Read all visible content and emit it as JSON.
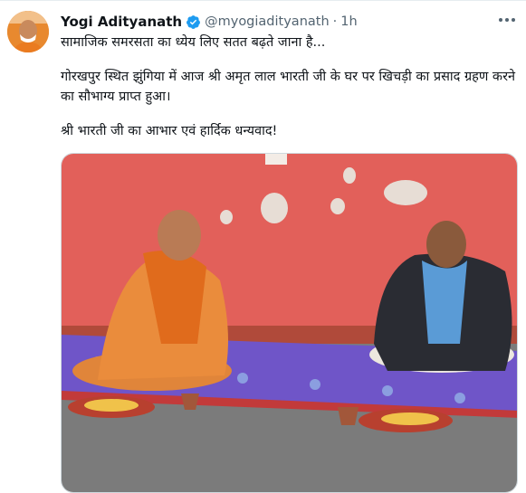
{
  "author": {
    "name": "Yogi Adityanath",
    "handle": "@myogiadityanath",
    "separator": "·",
    "time": "1h"
  },
  "tweet": {
    "line1": "सामाजिक समरसता का ध्येय लिए सतत बढ़ते जाना है...",
    "line2": "गोरखपुर स्थित झुंगिया में आज श्री अमृत लाल भारती जी के घर पर खिचड़ी का प्रसाद ग्रहण करने का सौभाग्य प्राप्त हुआ।",
    "line3": "श्री भारती जी का आभार एवं हार्दिक धन्यवाद!"
  },
  "colors": {
    "verified": "#1d9bf0",
    "wall": "#e2605a",
    "floor": "#7b7b7b",
    "mat": "#6f55c8"
  },
  "icons": {
    "verified": "verified-badge-icon",
    "more": "more-options-icon"
  }
}
